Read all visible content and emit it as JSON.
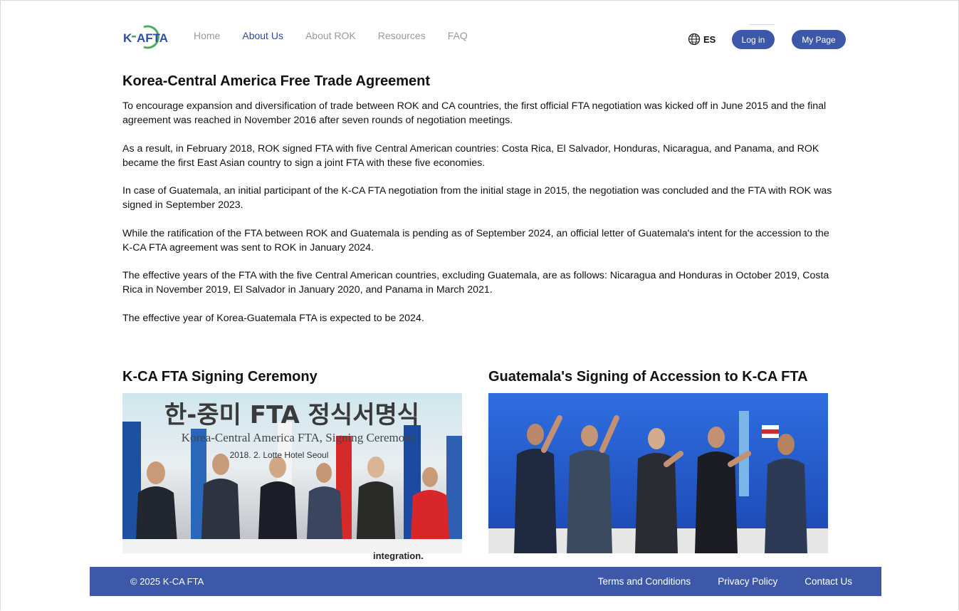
{
  "header": {
    "logo_text": "K-AFTA",
    "nav": [
      {
        "label": "Home",
        "active": false
      },
      {
        "label": "About Us",
        "active": true
      },
      {
        "label": "About ROK",
        "active": false
      },
      {
        "label": "Resources",
        "active": false
      },
      {
        "label": "FAQ",
        "active": false
      }
    ],
    "language": "ES",
    "login_label": "Log in",
    "mypage_label": "My Page"
  },
  "main": {
    "title": "Korea-Central America Free Trade Agreement",
    "paragraphs": [
      "To encourage expansion and diversification of trade between ROK and CA countries, the first official FTA negotiation was kicked off in June 2015 and the final agreement was reached in November 2016 after seven rounds of negotiation meetings.",
      "As a result, in February 2018, ROK signed FTA with five Central American countries: Costa Rica, El Salvador, Honduras, Nicaragua, and Panama, and ROK became the first East Asian country to sign a joint FTA with these five economies.",
      "In case of Guatemala, an initial participant of the K-CA FTA negotiation from the initial stage in 2015, the negotiation was concluded and the FTA with ROK was signed in September 2023.",
      "While the ratification of the FTA between ROK and Guatemala is pending as of September 2024, an official letter of Guatemala's intent for the accession to the K-CA FTA agreement was sent to ROK in January 2024.",
      "The effective years of the FTA with the five Central American countries, excluding Guatemala, are as follows: Nicaragua and Honduras in October 2019, Costa Rica in November 2019, El Salvador in January 2020, and Panama in March 2021.",
      "The effective year of Korea-Guatemala FTA is expected to be 2024."
    ]
  },
  "gallery": {
    "left": {
      "title": "K-CA FTA Signing Ceremony",
      "banner_korean": "한-중미 FTA 정식서명식",
      "banner_english": "Korea-Central America FTA, Signing Ceremony",
      "banner_sub": "2018. 2.       Lotte Hotel Seoul"
    },
    "right": {
      "title": "Guatemala's Signing of Accession to K-CA FTA"
    },
    "caption": "integration."
  },
  "footer": {
    "copyright": "© 2025 K-CA FTA",
    "links": [
      "Terms and Conditions",
      "Privacy Policy",
      "Contact Us"
    ]
  },
  "colors": {
    "primary": "#3d58a8",
    "nav_active": "#2f4a9a",
    "logo_green": "#4cae5a",
    "logo_blue": "#2d4ea2"
  }
}
